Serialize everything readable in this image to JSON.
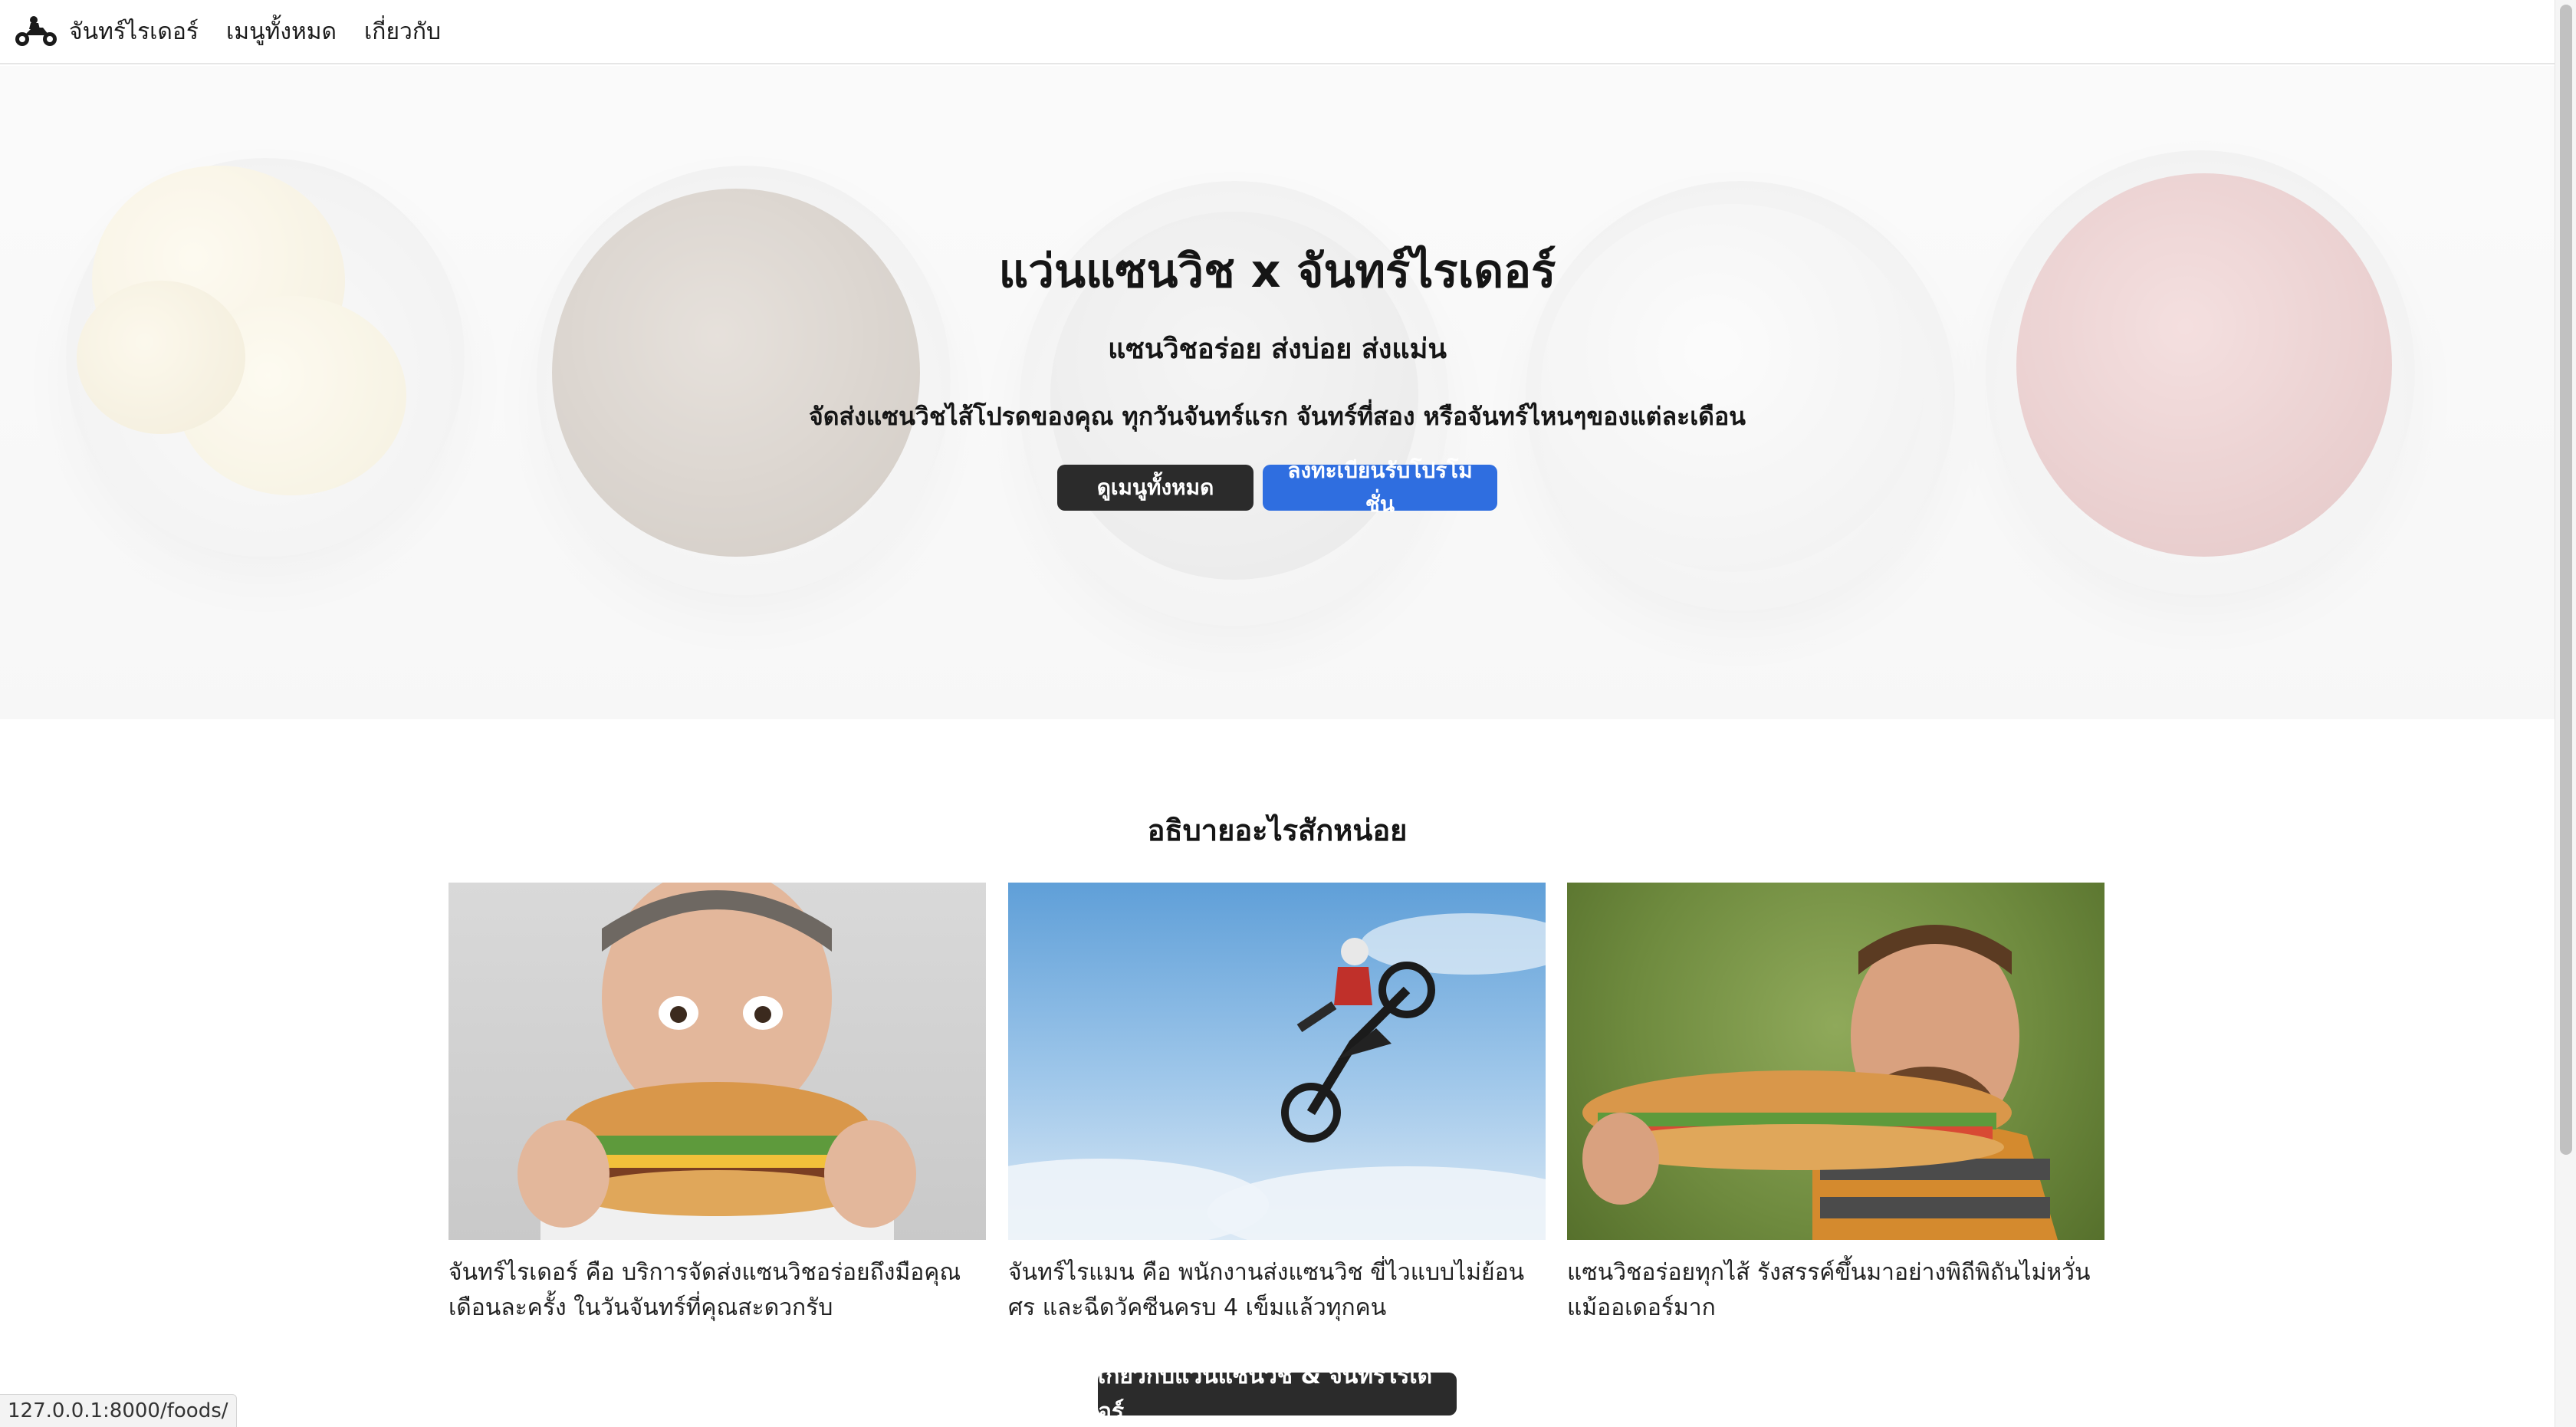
{
  "navbar": {
    "brand_label": "จันทร์ไรเดอร์",
    "links": [
      "เมนูทั้งหมด",
      "เกี่ยวกับ"
    ]
  },
  "hero": {
    "title": "แว่นแซนวิช x จันทร์ไรเดอร์",
    "subtitle": "แซนวิชอร่อย ส่งบ่อย ส่งแม่น",
    "description": "จัดส่งแซนวิชไส้โปรดของคุณ ทุกวันจันทร์แรก จันทร์ที่สอง หรือจันทร์ไหนๆของแต่ละเดือน",
    "buttons": {
      "menu": "ดูเมนูทั้งหมด",
      "register": "ลงทะเบียนรับโปรโมชั่น"
    }
  },
  "about": {
    "title": "อธิบายอะไรสักหน่อย",
    "cards": [
      {
        "text": "จันทร์ไรเดอร์ คือ บริการจัดส่งแซนวิชอร่อยถึงมือคุณ เดือนละครั้ง ในวันจันทร์ที่คุณสะดวกรับ"
      },
      {
        "text": "จันทร์ไรแมน คือ พนักงานส่งแซนวิช ขี่ไวแบบไม่ย้อนศร และฉีดวัคซีนครบ 4 เข็มแล้วทุกคน"
      },
      {
        "text": "แซนวิชอร่อยทุกไส้ รังสรรค์ขึ้นมาอย่างพิถีพิถันไม่หวั่นแม้ออเดอร์มาก"
      }
    ],
    "footer_button": "เกี่ยวกับแว่นแซนวิช & จันทร์ไรเดอร์"
  },
  "status_bar": {
    "url": "127.0.0.1:8000/foods/"
  },
  "colors": {
    "primary_blue": "#2f6ee0",
    "dark_button": "#2b2b2b"
  },
  "icons": {
    "brand": "motorbike-rider-icon"
  }
}
